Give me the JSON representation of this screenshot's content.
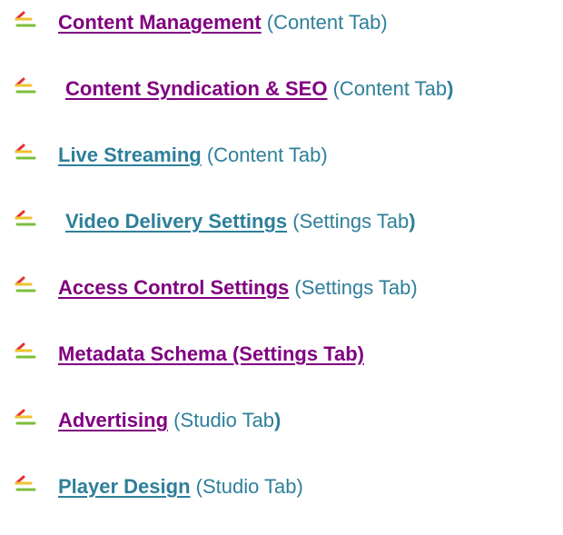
{
  "items": [
    {
      "link": "Content Management",
      "suffix": " (Content Tab)",
      "link_color": "purple"
    },
    {
      "link": "Content Syndication & SEO",
      "suffix_pre": " (Content Tab",
      "suffix_bold": ")",
      "link_color": "purple"
    },
    {
      "link": "Live Streaming",
      "suffix": " (Content Tab)",
      "link_color": "teal"
    },
    {
      "link": "Video Delivery Settings",
      "suffix_pre": " (Settings Tab",
      "suffix_bold": ")",
      "link_color": "teal"
    },
    {
      "link": "Access Control Settings",
      "suffix": " (Settings Tab)",
      "link_color": "purple"
    },
    {
      "link": "Metadata Schema (Settings Tab)",
      "link_color": "purple"
    },
    {
      "link": "Advertising",
      "suffix_pre": " (Studio Tab",
      "suffix_bold": ")",
      "link_color": "purple"
    },
    {
      "link": "Player Design",
      "suffix": " (Studio Tab)",
      "link_color": "teal"
    }
  ],
  "colors": {
    "visited_link": "#800080",
    "link": "#2E7F9A",
    "text": "#2E7F9A",
    "bullet_red": "#E8302E",
    "bullet_yellow": "#F2C230",
    "bullet_green": "#7DBE3C"
  },
  "bullet_icon": "striped-bullet-icon"
}
